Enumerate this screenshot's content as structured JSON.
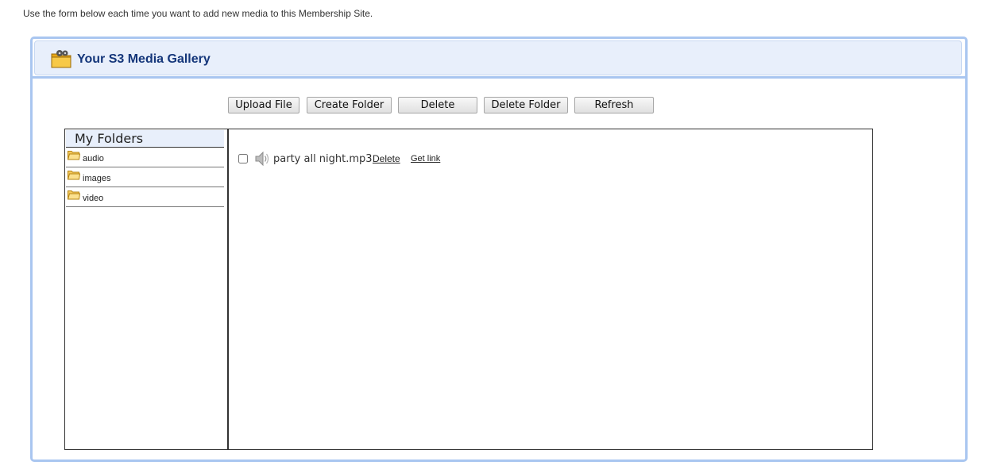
{
  "intro_text": "Use the form below each time you want to add new media to this Membership Site.",
  "gallery": {
    "title": "Your S3 Media Gallery",
    "icon": "film-folder-icon"
  },
  "toolbar": {
    "upload_file": "Upload File",
    "create_folder": "Create Folder",
    "delete": "Delete",
    "delete_folder": "Delete Folder",
    "refresh": "Refresh"
  },
  "folders": {
    "title": "My Folders",
    "items": [
      {
        "label": "audio",
        "icon": "folder-icon",
        "selected": true
      },
      {
        "label": "images",
        "icon": "folder-icon"
      },
      {
        "label": "video",
        "icon": "folder-icon"
      }
    ]
  },
  "files": [
    {
      "name": "party all night.mp3",
      "icon": "speaker-icon",
      "checked": false,
      "delete_label": "Delete",
      "get_link_label": "Get link"
    }
  ],
  "colors": {
    "panel_border": "#a9c6f0",
    "header_bg": "#e8effb",
    "title_color": "#14367a"
  }
}
